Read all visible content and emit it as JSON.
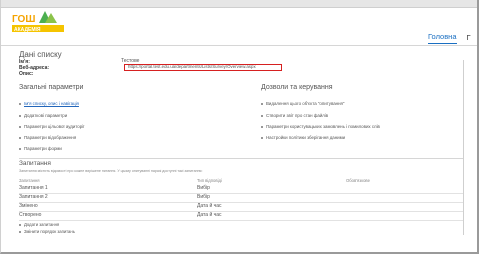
{
  "logo": {
    "text_top": "ГОШ",
    "text_bottom": "АКАДЕМІЯ"
  },
  "nav": {
    "tabs": [
      "Головна",
      "Г"
    ]
  },
  "page": {
    "title": "Дані списку",
    "fields": [
      {
        "label": "Ім'я:",
        "value": "Тестове"
      },
      {
        "label": "Веб-адреса:",
        "value": "https://portal.test.edu.ua/departments/Lists/Survey/Overview.aspx"
      },
      {
        "label": "Опис:",
        "value": ""
      }
    ]
  },
  "general": {
    "title": "Загальні параметри",
    "items": [
      "Ім'я списку, опис і навігація",
      "Додаткові параметри",
      "Параметри цільової аудиторії",
      "Параметри відображення",
      "Параметри форми"
    ]
  },
  "permissions": {
    "title": "Дозволи та керування",
    "items": [
      "Видалення цього об'єкта \"опитування\"",
      "Створити звіт про стан файлів",
      "Параметри користувацьких замовлень і помилових слів",
      "Настройки політики зберігання даними"
    ]
  },
  "columns": {
    "title": "Запитання",
    "description": "Запитання містить відомості про кожне вирішене питання. У цьому опитуванні наразі доступні такі запитання:",
    "headers": [
      "Запитання",
      "Тип відповіді",
      "Обов'язкове"
    ],
    "rows": [
      [
        "Запитання 1",
        "Вибір"
      ],
      [
        "Запитання 2",
        "Вибір"
      ],
      [
        "Змінено",
        "Дата й час"
      ],
      [
        "Створено",
        "Дата й час"
      ]
    ]
  },
  "footer_links": [
    "Додати запитання",
    "Змінити порядок запитань"
  ]
}
